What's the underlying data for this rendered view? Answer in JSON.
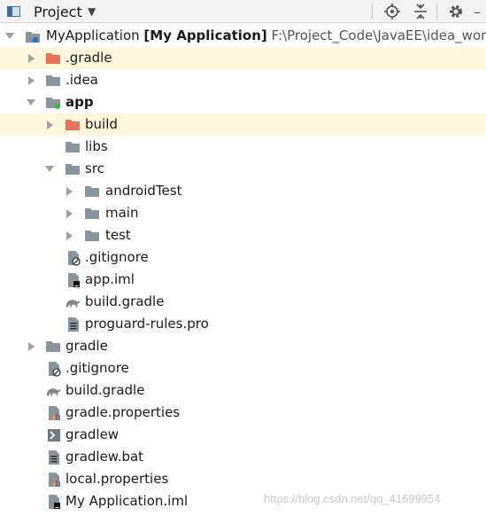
{
  "toolbar": {
    "view_title": "Project",
    "icons": [
      "project-view-icon",
      "dropdown-caret-icon",
      "locate-icon",
      "collapse-all-icon",
      "gear-icon",
      "hide-icon"
    ]
  },
  "tree": {
    "root": {
      "name": "MyApplication",
      "module": "[My Application]",
      "path": "F:\\Project_Code\\JavaEE\\idea_works"
    },
    "items": [
      {
        "label": ".gradle",
        "icon": "folder-excluded-icon"
      },
      {
        "label": ".idea",
        "icon": "folder-icon"
      },
      {
        "label": "app",
        "icon": "module-folder-icon"
      },
      {
        "label": "build",
        "icon": "folder-excluded-icon"
      },
      {
        "label": "libs",
        "icon": "folder-icon"
      },
      {
        "label": "src",
        "icon": "folder-icon"
      },
      {
        "label": "androidTest",
        "icon": "folder-icon"
      },
      {
        "label": "main",
        "icon": "folder-icon"
      },
      {
        "label": "test",
        "icon": "folder-icon"
      },
      {
        "label": ".gitignore",
        "icon": "ignore-file-icon"
      },
      {
        "label": "app.iml",
        "icon": "iml-file-icon"
      },
      {
        "label": "build.gradle",
        "icon": "gradle-file-icon"
      },
      {
        "label": "proguard-rules.pro",
        "icon": "text-file-icon"
      },
      {
        "label": "gradle",
        "icon": "folder-icon"
      },
      {
        "label": ".gitignore",
        "icon": "ignore-file-icon"
      },
      {
        "label": "build.gradle",
        "icon": "gradle-file-icon"
      },
      {
        "label": "gradle.properties",
        "icon": "properties-file-icon"
      },
      {
        "label": "gradlew",
        "icon": "shell-script-icon"
      },
      {
        "label": "gradlew.bat",
        "icon": "text-file-icon"
      },
      {
        "label": "local.properties",
        "icon": "properties-file-icon"
      },
      {
        "label": "My Application.iml",
        "icon": "iml-file-icon"
      }
    ]
  },
  "watermark": "https://blog.csdn.net/qq_41699954",
  "colors": {
    "highlight": "#fdf7dc",
    "folder": "#8a949c",
    "excluded_folder": "#e8735a",
    "toolbar_bg": "#f2f2f2"
  }
}
